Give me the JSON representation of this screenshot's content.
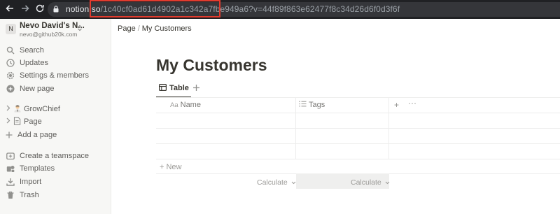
{
  "browser": {
    "back_icon": "arrow-left-icon",
    "forward_icon": "arrow-right-icon",
    "reload_icon": "reload-icon",
    "lock_icon": "lock-icon",
    "url_host": "notion.so",
    "url_path": "/1c40cf0ad61d4902a1c342a7fbe949a6?v=44f89f863e62477f8c34d26d6f0d3f6f"
  },
  "workspace": {
    "avatar_letter": "N",
    "name": "Nevo David's N...",
    "email": "nevo@github20k.com",
    "switch_icon": "chevron-updown-icon"
  },
  "sidebar": {
    "items": [
      {
        "label": "Search",
        "icon": "search-icon"
      },
      {
        "label": "Updates",
        "icon": "clock-icon"
      },
      {
        "label": "Settings & members",
        "icon": "gear-icon"
      },
      {
        "label": "New page",
        "icon": "plus-circle-icon"
      }
    ],
    "pages": [
      {
        "label": "GrowChief",
        "icon": "person-emoji-icon"
      },
      {
        "label": "Page",
        "icon": "document-icon"
      }
    ],
    "add_page": "Add a page",
    "bottom": [
      {
        "label": "Create a teamspace",
        "icon": "teamspace-icon"
      },
      {
        "label": "Templates",
        "icon": "templates-icon"
      },
      {
        "label": "Import",
        "icon": "import-icon"
      },
      {
        "label": "Trash",
        "icon": "trash-icon"
      }
    ]
  },
  "breadcrumb": {
    "parent": "Page",
    "separator": "/",
    "current": "My Customers"
  },
  "page": {
    "title": "My Customers",
    "view_tab": "Table",
    "add_view_icon": "plus-icon"
  },
  "table": {
    "columns": [
      {
        "label": "Name",
        "icon_text": "Aa"
      },
      {
        "label": "Tags",
        "icon": "list-icon"
      }
    ],
    "add_column": "+",
    "more": "···",
    "new_row": "+ New",
    "calculate": [
      "Calculate",
      "Calculate"
    ]
  },
  "colors": {
    "highlight_border": "#e23b2e",
    "browser_bg": "#202124",
    "sidebar_bg": "#f7f7f5",
    "text_primary": "#37352f"
  }
}
